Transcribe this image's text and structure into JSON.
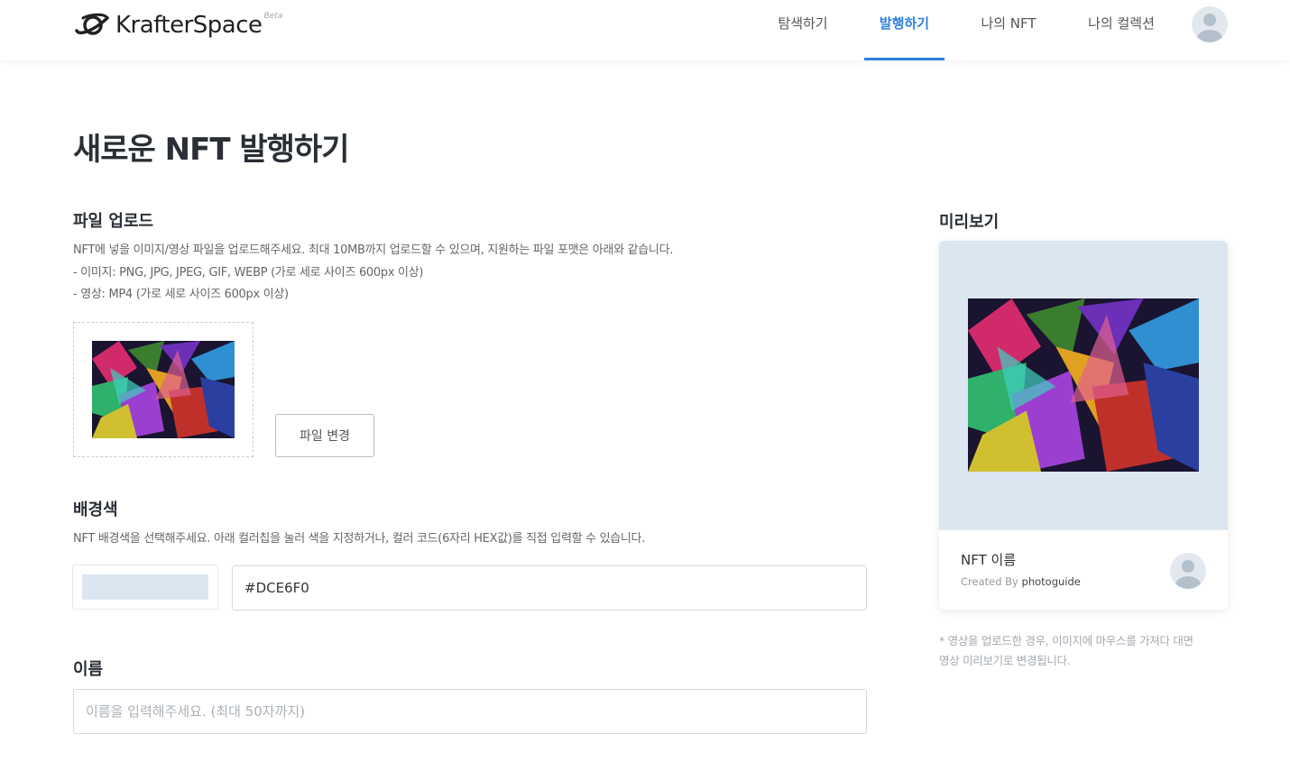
{
  "header": {
    "logo_text": "KrafterSpace",
    "logo_badge": "Beta",
    "nav": [
      {
        "label": "탐색하기",
        "active": false
      },
      {
        "label": "발행하기",
        "active": true
      },
      {
        "label": "나의 NFT",
        "active": false
      },
      {
        "label": "나의 컬렉션",
        "active": false
      }
    ]
  },
  "page": {
    "title": "새로운 NFT 발행하기"
  },
  "upload": {
    "title": "파일 업로드",
    "desc_lines": [
      "NFT에 넣을 이미지/영상 파일을 업로드해주세요. 최대 10MB까지 업로드할 수 있으며, 지원하는 파일 포맷은 아래와 같습니다.",
      "- 이미지: PNG, JPG, JPEG, GIF, WEBP (가로 세로 사이즈 600px 이상)",
      "- 영상: MP4 (가로 세로 사이즈 600px 이상)"
    ],
    "change_button": "파일 변경"
  },
  "background": {
    "title": "배경색",
    "desc": "NFT 배경색을 선택해주세요. 아래 컬러칩을 눌러 색을 지정하거나, 컬러 코드(6자리 HEX값)를 직접 입력할 수 있습니다.",
    "color_value": "#DCE6F0"
  },
  "name": {
    "title": "이름",
    "placeholder": "이름을 입력해주세요. (최대 50자까지)"
  },
  "preview": {
    "title": "미리보기",
    "nft_name": "NFT 이름",
    "created_by_label": "Created By",
    "creator": "photoguide",
    "note_lines": [
      "* 영상을 업로드한 경우, 이미지에 마우스를 가져다 대면",
      "영상 미리보기로 변경됩니다."
    ]
  },
  "colors": {
    "accent": "#2f7fe0",
    "preview_bg": "#DCE6F0",
    "avatar_bg": "#e3e8ef",
    "avatar_fg": "#b4c0cc"
  },
  "icons": {
    "logo": "planet-ring-logo-icon",
    "avatar": "user-avatar-icon",
    "thumbnail": "uploaded-image-thumbnail"
  }
}
